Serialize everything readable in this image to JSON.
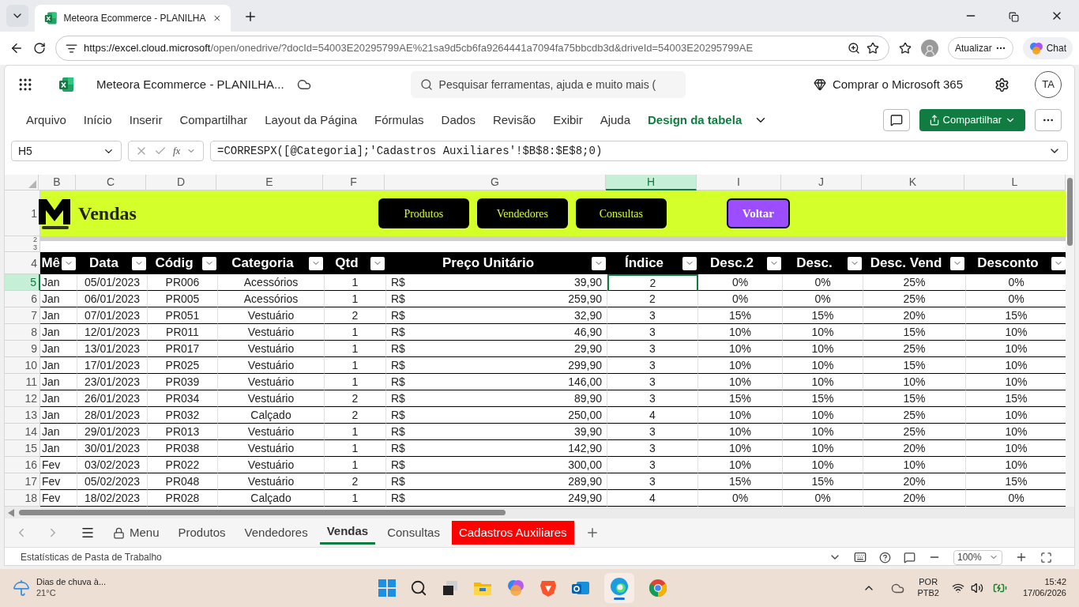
{
  "browser": {
    "tab_title": "Meteora Ecommerce - PLANILHA",
    "url_host": "https://excel.cloud.microsoft",
    "url_path": "/open/onedrive/?docId=54003E20295799AE%21sa9d5cb6fa9264441a7094fa75bbcdb3d&driveId=54003E20295799AE",
    "update_button": "Atualizar",
    "chat_button": "Chat"
  },
  "excel": {
    "app_title": "Meteora Ecommerce - PLANILHA...",
    "search_placeholder": "Pesquisar ferramentas, ajuda e muito mais (",
    "buy_label": "Comprar o Microsoft 365",
    "avatar": "TA",
    "ribbon_tabs": [
      {
        "label": "Arquivo",
        "selected": false
      },
      {
        "label": "Início",
        "selected": false
      },
      {
        "label": "Inserir",
        "selected": false
      },
      {
        "label": "Compartilhar",
        "selected": false
      },
      {
        "label": "Layout da Página",
        "selected": false
      },
      {
        "label": "Fórmulas",
        "selected": false
      },
      {
        "label": "Dados",
        "selected": false
      },
      {
        "label": "Revisão",
        "selected": false
      },
      {
        "label": "Exibir",
        "selected": false
      },
      {
        "label": "Ajuda",
        "selected": false
      },
      {
        "label": "Design da tabela",
        "selected": true
      }
    ],
    "share_button": "Compartilhar",
    "name_box": "H5",
    "function_label": "fx",
    "formula": "=CORRESPX([@Categoria];'Cadastros Auxiliares'!$B$8:$E$8;0)"
  },
  "sheet": {
    "columns": [
      {
        "label": "B",
        "selected": false
      },
      {
        "label": "C",
        "selected": false
      },
      {
        "label": "D",
        "selected": false
      },
      {
        "label": "E",
        "selected": false
      },
      {
        "label": "F",
        "selected": false
      },
      {
        "label": "G",
        "selected": false
      },
      {
        "label": "H",
        "selected": true
      },
      {
        "label": "I",
        "selected": false
      },
      {
        "label": "J",
        "selected": false
      },
      {
        "label": "K",
        "selected": false
      },
      {
        "label": "L",
        "selected": false
      }
    ],
    "banner": {
      "row": "1",
      "title": "Vendas",
      "buttons": [
        {
          "label": "Produtos",
          "kind": "nav"
        },
        {
          "label": "Vendedores",
          "kind": "nav"
        },
        {
          "label": "Consultas",
          "kind": "nav"
        },
        {
          "label": "Voltar",
          "kind": "back"
        }
      ]
    },
    "spacer_rows": [
      "2",
      "3"
    ],
    "table": {
      "row": "4",
      "headers": [
        "Mê",
        "Data",
        "Códig",
        "Categoria",
        "Qtd",
        "Preço Unitário",
        "Índice",
        "Desc.2",
        "Desc.",
        "Desc. Vend",
        "Desconto"
      ],
      "rows": [
        {
          "row": "5",
          "selected": true,
          "cells": [
            "Jan",
            "05/01/2023",
            "PR006",
            "Acessórios",
            "1",
            {
              "currency": "R$",
              "amount": "39,90"
            },
            "2",
            "0%",
            "0%",
            "25%",
            "0%"
          ]
        },
        {
          "row": "6",
          "selected": false,
          "cells": [
            "Jan",
            "06/01/2023",
            "PR005",
            "Acessórios",
            "1",
            {
              "currency": "R$",
              "amount": "259,90"
            },
            "2",
            "0%",
            "0%",
            "25%",
            "0%"
          ]
        },
        {
          "row": "7",
          "selected": false,
          "cells": [
            "Jan",
            "07/01/2023",
            "PR051",
            "Vestuário",
            "2",
            {
              "currency": "R$",
              "amount": "32,90"
            },
            "3",
            "15%",
            "15%",
            "20%",
            "15%"
          ]
        },
        {
          "row": "8",
          "selected": false,
          "cells": [
            "Jan",
            "12/01/2023",
            "PR011",
            "Vestuário",
            "1",
            {
              "currency": "R$",
              "amount": "46,90"
            },
            "3",
            "10%",
            "10%",
            "15%",
            "10%"
          ]
        },
        {
          "row": "9",
          "selected": false,
          "cells": [
            "Jan",
            "13/01/2023",
            "PR017",
            "Vestuário",
            "1",
            {
              "currency": "R$",
              "amount": "29,90"
            },
            "3",
            "10%",
            "10%",
            "25%",
            "10%"
          ]
        },
        {
          "row": "10",
          "selected": false,
          "cells": [
            "Jan",
            "17/01/2023",
            "PR025",
            "Vestuário",
            "1",
            {
              "currency": "R$",
              "amount": "299,90"
            },
            "3",
            "10%",
            "10%",
            "15%",
            "10%"
          ]
        },
        {
          "row": "11",
          "selected": false,
          "cells": [
            "Jan",
            "23/01/2023",
            "PR039",
            "Vestuário",
            "1",
            {
              "currency": "R$",
              "amount": "146,00"
            },
            "3",
            "10%",
            "10%",
            "10%",
            "10%"
          ]
        },
        {
          "row": "12",
          "selected": false,
          "cells": [
            "Jan",
            "26/01/2023",
            "PR034",
            "Vestuário",
            "2",
            {
              "currency": "R$",
              "amount": "89,90"
            },
            "3",
            "15%",
            "15%",
            "15%",
            "15%"
          ]
        },
        {
          "row": "13",
          "selected": false,
          "cells": [
            "Jan",
            "28/01/2023",
            "PR032",
            "Calçado",
            "2",
            {
              "currency": "R$",
              "amount": "250,00"
            },
            "4",
            "10%",
            "10%",
            "25%",
            "10%"
          ]
        },
        {
          "row": "14",
          "selected": false,
          "cells": [
            "Jan",
            "29/01/2023",
            "PR013",
            "Vestuário",
            "1",
            {
              "currency": "R$",
              "amount": "39,90"
            },
            "3",
            "10%",
            "10%",
            "25%",
            "10%"
          ]
        },
        {
          "row": "15",
          "selected": false,
          "cells": [
            "Jan",
            "30/01/2023",
            "PR038",
            "Vestuário",
            "1",
            {
              "currency": "R$",
              "amount": "142,90"
            },
            "3",
            "10%",
            "10%",
            "20%",
            "10%"
          ]
        },
        {
          "row": "16",
          "selected": false,
          "cells": [
            "Fev",
            "03/02/2023",
            "PR022",
            "Vestuário",
            "1",
            {
              "currency": "R$",
              "amount": "300,00"
            },
            "3",
            "10%",
            "10%",
            "10%",
            "10%"
          ]
        },
        {
          "row": "17",
          "selected": false,
          "cells": [
            "Fev",
            "05/02/2023",
            "PR048",
            "Vestuário",
            "2",
            {
              "currency": "R$",
              "amount": "289,90"
            },
            "3",
            "15%",
            "15%",
            "20%",
            "15%"
          ]
        },
        {
          "row": "18",
          "selected": false,
          "cells": [
            "Fev",
            "18/02/2023",
            "PR028",
            "Calçado",
            "1",
            {
              "currency": "R$",
              "amount": "249,90"
            },
            "4",
            "0%",
            "0%",
            "20%",
            "0%"
          ]
        }
      ]
    }
  },
  "sheet_tabs": [
    {
      "label": "Menu",
      "kind": "locked",
      "selected": false
    },
    {
      "label": "Produtos",
      "kind": "sheet",
      "selected": false
    },
    {
      "label": "Vendedores",
      "kind": "sheet",
      "selected": false
    },
    {
      "label": "Vendas",
      "kind": "sheet",
      "selected": true
    },
    {
      "label": "Consultas",
      "kind": "sheet",
      "selected": false
    },
    {
      "label": "Cadastros Auxiliares",
      "kind": "sheet",
      "selected": false,
      "color": "#ff0000"
    }
  ],
  "status_bar": {
    "text": "Estatísticas de Pasta de Trabalho",
    "zoom": "100%"
  },
  "taskbar": {
    "weather": "Dias de chuva à...",
    "temperature": "21°C",
    "language": "POR",
    "layout": "PTB2",
    "time": "15:42",
    "date": "17/06/2026"
  }
}
